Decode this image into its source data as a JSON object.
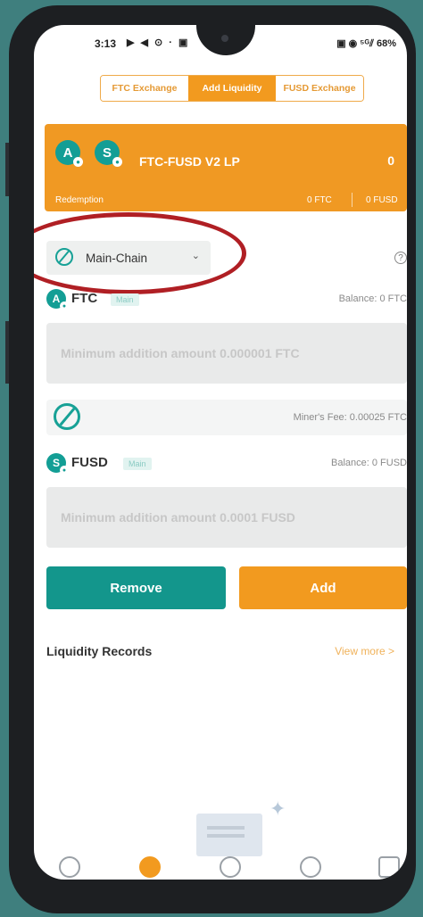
{
  "status_bar": {
    "time": "3:13",
    "left_icons": "▶ ◀ ⊙ · ▣",
    "right_icons": "▣ ◉ ⁵ᴳ⫽",
    "battery": "68%"
  },
  "tabs": [
    {
      "label": "FTC Exchange",
      "active": false
    },
    {
      "label": "Add Liquidity",
      "active": true
    },
    {
      "label": "FUSD Exchange",
      "active": false
    }
  ],
  "lp_card": {
    "coin1_symbol": "A",
    "coin2_symbol": "S",
    "pair_name": "FTC-FUSD V2 LP",
    "amount": "0",
    "redemption_label": "Redemption",
    "redemption_ftc": "0 FTC",
    "redemption_fusd": "0 FUSD"
  },
  "chain_selector": {
    "label": "Main-Chain",
    "caret": "⌄"
  },
  "help_icon": "?",
  "ftc": {
    "coin_symbol": "A",
    "name": "FTC",
    "badge": "Main",
    "balance": "Balance: 0 FTC",
    "placeholder": "Minimum addition amount 0.000001 FTC"
  },
  "fee": {
    "text": "Miner's Fee: 0.00025 FTC"
  },
  "fusd": {
    "coin_symbol": "S",
    "name": "FUSD",
    "badge": "Main",
    "balance": "Balance: 0 FUSD",
    "placeholder": "Minimum addition amount 0.0001 FUSD"
  },
  "buttons": {
    "remove": "Remove",
    "add": "Add"
  },
  "records": {
    "title": "Liquidity Records",
    "view_more": "View more >"
  },
  "bottom_nav": [
    {
      "icon": "home-icon",
      "active": false
    },
    {
      "icon": "liquidity-icon",
      "active": true
    },
    {
      "icon": "compass-icon",
      "active": false
    },
    {
      "icon": "discover-icon",
      "active": false
    },
    {
      "icon": "profile-icon",
      "active": false
    }
  ],
  "colors": {
    "accent_orange": "#f29a1f",
    "accent_teal": "#13968c",
    "annotation_red": "#b01f24"
  }
}
